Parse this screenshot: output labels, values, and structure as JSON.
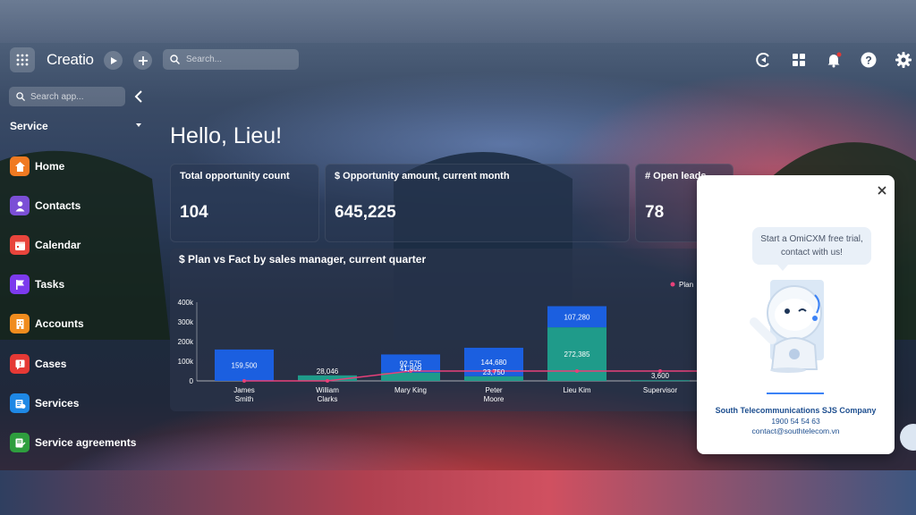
{
  "topbar": {
    "logo": "Creatio",
    "search_placeholder": "Search...",
    "icons": [
      "apps-grid-icon",
      "play-icon",
      "plus-icon",
      "search-icon",
      "creatio-ai-icon",
      "widgets-icon",
      "bell-icon",
      "help-icon",
      "gear-icon"
    ]
  },
  "sidebar": {
    "search_placeholder": "Search app...",
    "section": "Service",
    "items": [
      {
        "label": "Home",
        "color": "#f07a22",
        "icon": "home-icon"
      },
      {
        "label": "Contacts",
        "color": "#7b4fd6",
        "icon": "person-icon"
      },
      {
        "label": "Calendar",
        "color": "#e8453c",
        "icon": "calendar-icon"
      },
      {
        "label": "Tasks",
        "color": "#7c3aed",
        "icon": "flag-icon"
      },
      {
        "label": "Accounts",
        "color": "#f08c1e",
        "icon": "building-icon"
      },
      {
        "label": "Cases",
        "color": "#e53935",
        "icon": "case-icon"
      },
      {
        "label": "Services",
        "color": "#1e88e5",
        "icon": "services-icon"
      },
      {
        "label": "Service agreements",
        "color": "#2e9e3e",
        "icon": "agreement-icon"
      }
    ]
  },
  "main": {
    "greeting": "Hello, Lieu!",
    "kpis": [
      {
        "title": "Total opportunity count",
        "value": "104"
      },
      {
        "title": "$ Opportunity amount, current month",
        "value": "645,225"
      },
      {
        "title": "# Open leads",
        "value": "78"
      }
    ],
    "chart_title": "$ Plan vs Fact by sales manager, current quarter",
    "legend_plan": "Plan"
  },
  "chart_data": {
    "type": "bar",
    "title": "$ Plan vs Fact by sales manager, current quarter",
    "categories": [
      "James Smith",
      "William Clarks",
      "Mary King",
      "Peter Moore",
      "Lieu Kim",
      "Supervisor"
    ],
    "yticks": [
      "0",
      "100k",
      "200k",
      "300k",
      "400k"
    ],
    "ylim": [
      0,
      400000
    ],
    "series": [
      {
        "color": "#1b5fe0",
        "values": [
          159500,
          0,
          92575,
          144680,
          107280,
          0
        ],
        "labels": [
          "159,500",
          "",
          "92,575",
          "144,680",
          "107,280",
          ""
        ]
      },
      {
        "color": "#1f9b8a",
        "values": [
          0,
          28046,
          41809,
          23750,
          272385,
          3600
        ],
        "labels": [
          "",
          "28,046",
          "41,809",
          "23,750",
          "272,385",
          "3,600"
        ]
      },
      {
        "name": "Plan",
        "type": "line",
        "color": "#e8407a",
        "values": [
          0,
          0,
          50000,
          50000,
          50000,
          50000
        ]
      }
    ],
    "legend": "top-right"
  },
  "popup": {
    "bubble_text": "Start a OmiCXM free trial, contact with us!",
    "company": "South Telecommunications SJS Company",
    "phone": "1900 54 54 63",
    "email": "contact@southtelecom.vn"
  }
}
